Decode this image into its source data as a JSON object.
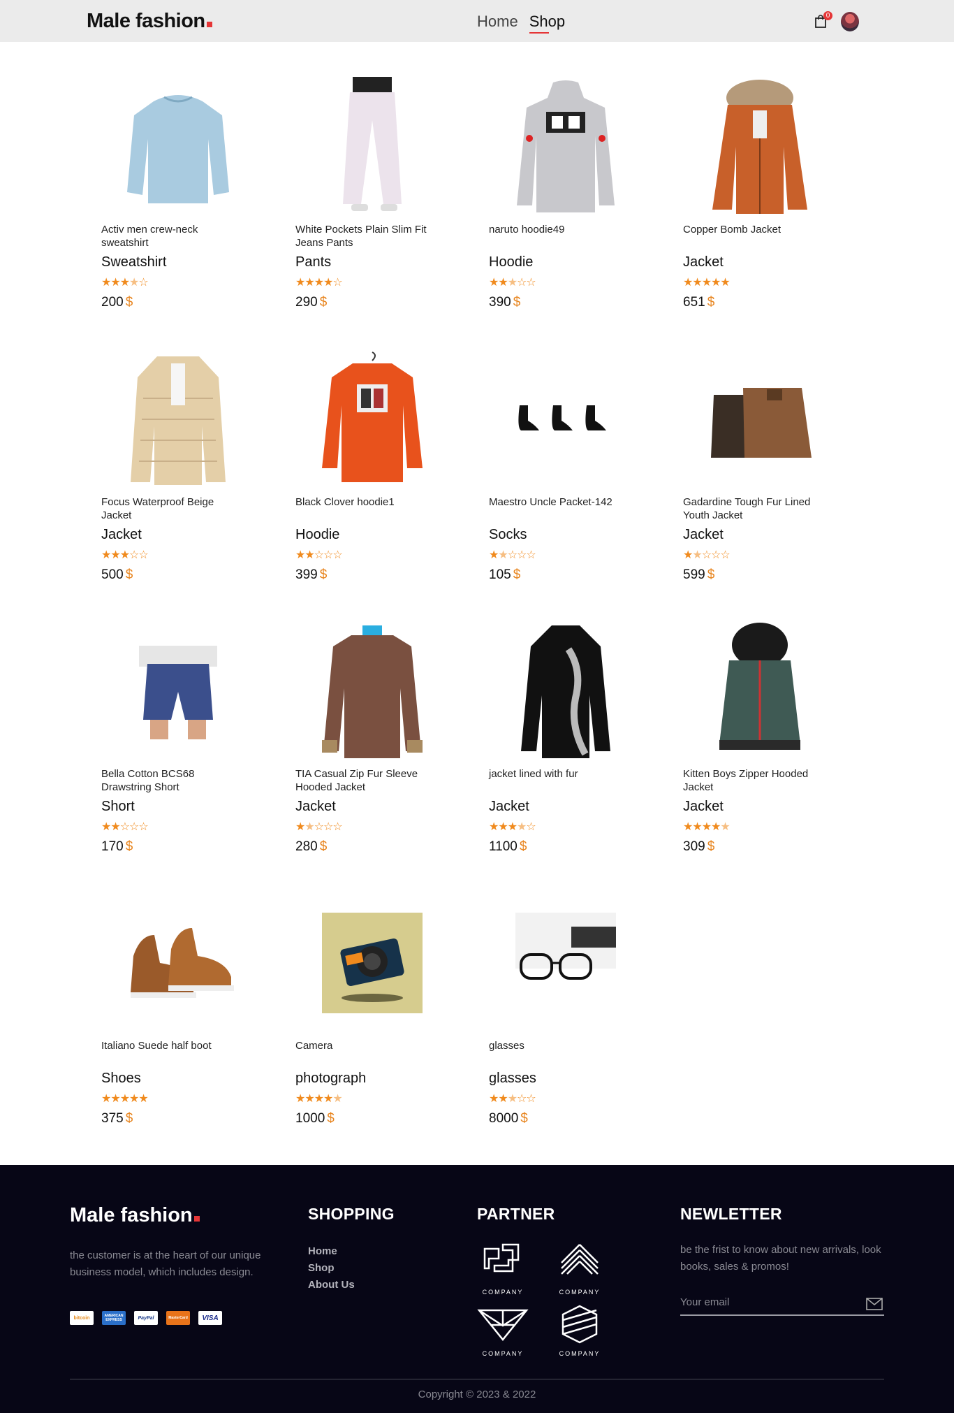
{
  "brand": {
    "name": "Male fashion"
  },
  "nav": {
    "home": "Home",
    "shop": "Shop"
  },
  "cart": {
    "count": "0"
  },
  "currency": "$",
  "products": [
    {
      "name": "Activ men crew-neck sweatshirt",
      "category": "Sweatshirt",
      "rating": 3.5,
      "price": "200",
      "icon": "sweatshirt"
    },
    {
      "name": "White Pockets Plain Slim Fit Jeans Pants",
      "category": "Pants",
      "rating": 4,
      "price": "290",
      "icon": "pants"
    },
    {
      "name": "naruto hoodie49",
      "category": "Hoodie",
      "rating": 2.5,
      "price": "390",
      "icon": "hoodie-gray"
    },
    {
      "name": "Copper Bomb Jacket",
      "category": "Jacket",
      "rating": 5,
      "price": "651",
      "icon": "jacket-copper"
    },
    {
      "name": "Focus Waterproof Beige Jacket",
      "category": "Jacket",
      "rating": 3,
      "price": "500",
      "icon": "jacket-beige"
    },
    {
      "name": "Black Clover hoodie1",
      "category": "Hoodie",
      "rating": 2,
      "price": "399",
      "icon": "hoodie-orange"
    },
    {
      "name": "Maestro Uncle Packet-142",
      "category": "Socks",
      "rating": 1.5,
      "price": "105",
      "icon": "socks"
    },
    {
      "name": "Gadardine Tough Fur Lined Youth Jacket",
      "category": "Jacket",
      "rating": 1.5,
      "price": "599",
      "icon": "jacket-brown"
    },
    {
      "name": "Bella Cotton BCS68 Drawstring Short",
      "category": "Short",
      "rating": 2,
      "price": "170",
      "icon": "short"
    },
    {
      "name": "TIA Casual Zip Fur Sleeve Hooded Jacket",
      "category": "Jacket",
      "rating": 1.5,
      "price": "280",
      "icon": "coat-brown"
    },
    {
      "name": "jacket lined with fur",
      "category": "Jacket",
      "rating": 3.5,
      "price": "1100",
      "icon": "coat-black"
    },
    {
      "name": "Kitten Boys Zipper Hooded Jacket",
      "category": "Jacket",
      "rating": 4.5,
      "price": "309",
      "icon": "vest-green"
    },
    {
      "name": "Italiano Suede half boot",
      "category": "Shoes",
      "rating": 5,
      "price": "375",
      "icon": "boot"
    },
    {
      "name": "Camera",
      "category": "photograph",
      "rating": 4.5,
      "price": "1000",
      "icon": "camera"
    },
    {
      "name": "glasses",
      "category": "glasses",
      "rating": 2.5,
      "price": "8000",
      "icon": "glasses"
    }
  ],
  "footer": {
    "brand": "Male fashion",
    "description": "the customer is at the heart of our unique business model, which includes design.",
    "payments": [
      "bitcoin",
      "AMERICAN EXPRESS",
      "PayPal",
      "MasterCard",
      "VISA"
    ],
    "shopping_title": "SHOPPING",
    "links": [
      "Home",
      "Shop",
      "About Us"
    ],
    "partner_title": "PARTNER",
    "partners": [
      "COMPANY",
      "COMPANY",
      "COMPANY",
      "COMPANY"
    ],
    "newsletter_title": "NEWLETTER",
    "newsletter_text": "be the frist to know about new arrivals, look books, sales & promos!",
    "email_placeholder": "Your email",
    "copyright": "Copyright © 2023 & 2022"
  }
}
